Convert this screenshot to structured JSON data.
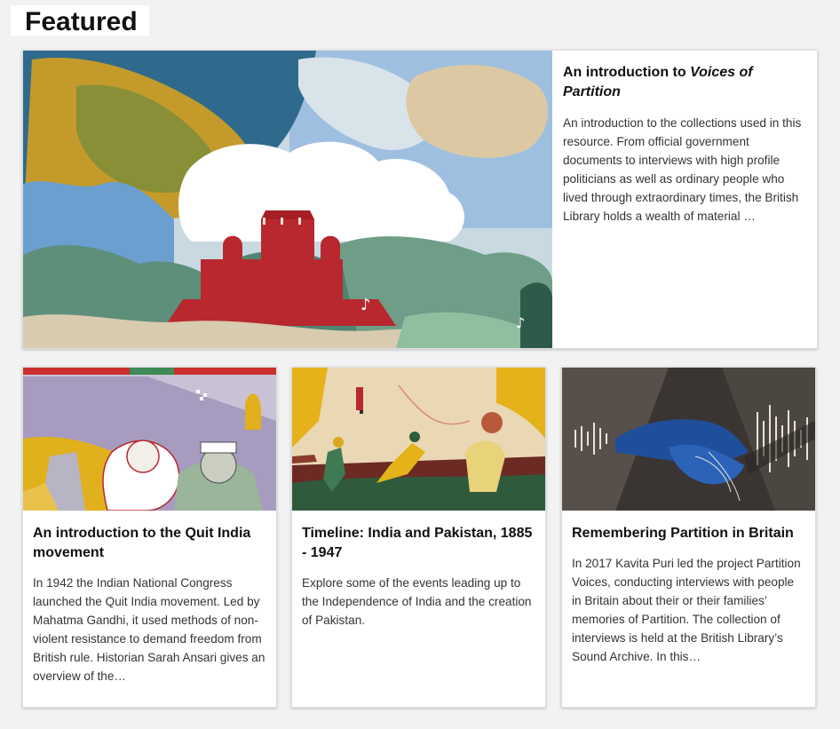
{
  "page": {
    "heading": "Featured"
  },
  "featured": {
    "title_prefix": "An introduction to ",
    "title_italic": "Voices of Partition",
    "description": "An introduction to the collections used in this resource. From official government documents to interviews with high profile politicians as well as ordinary people who lived through extraordinary times, the British Library holds a wealth of material …",
    "image_icon": "red-fort-illustration"
  },
  "cards": [
    {
      "title": "An introduction to the Quit India movement",
      "description": "In 1942 the Indian National Congress launched the Quit India movement. Led by Mahatma Gandhi, it used methods of non-violent resistance to demand freedom from British rule. Historian Sarah Ansari gives an overview of the…",
      "image_icon": "gandhi-nehru-illustration"
    },
    {
      "title": "Timeline: India and Pakistan, 1885 - 1947",
      "description": "Explore some of the events leading up to the Independence of India and the creation of Pakistan.",
      "image_icon": "running-figures-illustration"
    },
    {
      "title": "Remembering Partition in Britain",
      "description": "In 2017 Kavita Puri led the project Partition Voices, conducting interviews with people in Britain about their or their families’ memories of Partition. The collection of interviews is held at the British Library’s Sound Archive. In this…",
      "image_icon": "holding-hands-soundwave-illustration"
    }
  ],
  "colors": {
    "page_bg": "#f2f2f2",
    "card_bg": "#ffffff",
    "fort_red": "#b8282e",
    "sky_blue": "#7fa9d6",
    "ochre": "#d9a822",
    "teal_green": "#5d8f7a"
  }
}
